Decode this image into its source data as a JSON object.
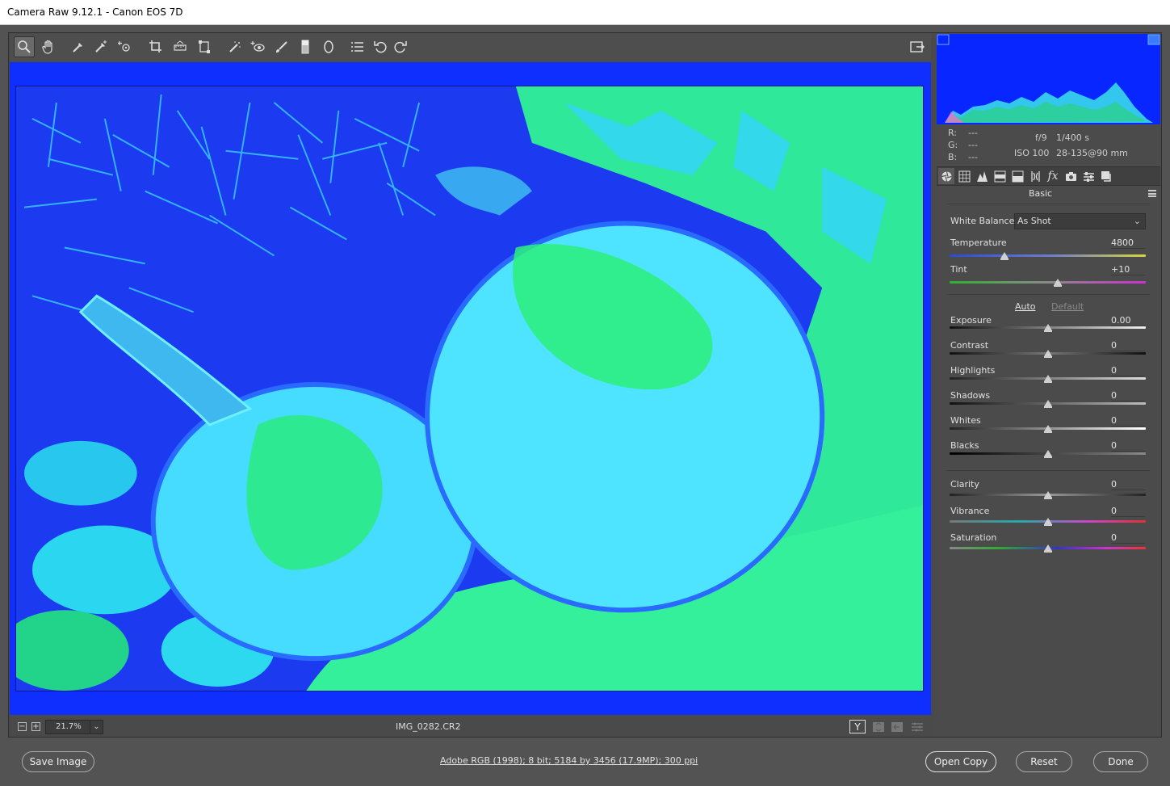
{
  "window": {
    "title": "Camera Raw 9.12.1  -  Canon EOS 7D"
  },
  "toolbar": {
    "tools": [
      "zoom-tool",
      "hand-tool",
      "white-balance-tool",
      "color-sampler-tool",
      "target-adjustment-tool",
      "crop-tool",
      "straighten-tool",
      "transform-tool",
      "spot-removal-tool",
      "red-eye-tool",
      "adjustment-brush-tool",
      "graduated-filter-tool",
      "radial-filter-tool",
      "preferences-tool",
      "rotate-ccw-tool",
      "rotate-cw-tool"
    ],
    "active_tool": "zoom-tool"
  },
  "preview": {
    "zoom": "21.7%",
    "filename": "IMG_0282.CR2",
    "colors": {
      "background": "#0e2fff",
      "image_sky": "#1033e6",
      "pumpkin": "#3ee8ff",
      "moss": "#22ff88"
    }
  },
  "histogram": {
    "colors": {
      "background": "#0826ff",
      "fill": "#33c7ee"
    }
  },
  "readout": {
    "r_label": "R:",
    "r_value": "---",
    "g_label": "G:",
    "g_value": "---",
    "b_label": "B:",
    "b_value": "---",
    "aperture": "f/9",
    "shutter": "1/400 s",
    "iso": "ISO 100",
    "lens": "28-135@90 mm"
  },
  "panel": {
    "tabs": [
      "basic-tab",
      "tone-curve-tab",
      "detail-tab",
      "hsl-tab",
      "split-toning-tab",
      "lens-corrections-tab",
      "effects-tab",
      "camera-calibration-tab",
      "presets-tab",
      "snapshots-tab"
    ],
    "title": "Basic",
    "white_balance": {
      "label": "White Balance:",
      "value": "As Shot"
    },
    "auto_label": "Auto",
    "default_label": "Default",
    "sliders": [
      {
        "label": "Temperature",
        "value": "4800",
        "level": 0.28
      },
      {
        "label": "Tint",
        "value": "+10",
        "level": 0.55
      },
      {
        "label": "Exposure",
        "value": "0.00",
        "level": 0.5
      },
      {
        "label": "Contrast",
        "value": "0",
        "level": 0.5
      },
      {
        "label": "Highlights",
        "value": "0",
        "level": 0.5
      },
      {
        "label": "Shadows",
        "value": "0",
        "level": 0.5
      },
      {
        "label": "Whites",
        "value": "0",
        "level": 0.5
      },
      {
        "label": "Blacks",
        "value": "0",
        "level": 0.5
      },
      {
        "label": "Clarity",
        "value": "0",
        "level": 0.5
      },
      {
        "label": "Vibrance",
        "value": "0",
        "level": 0.5
      },
      {
        "label": "Saturation",
        "value": "0",
        "level": 0.5
      }
    ]
  },
  "footer": {
    "save_label": "Save Image",
    "workflow_link": "Adobe RGB (1998); 8 bit; 5184 by 3456 (17.9MP); 300 ppi",
    "open_copy_label": "Open Copy",
    "reset_label": "Reset",
    "done_label": "Done"
  }
}
